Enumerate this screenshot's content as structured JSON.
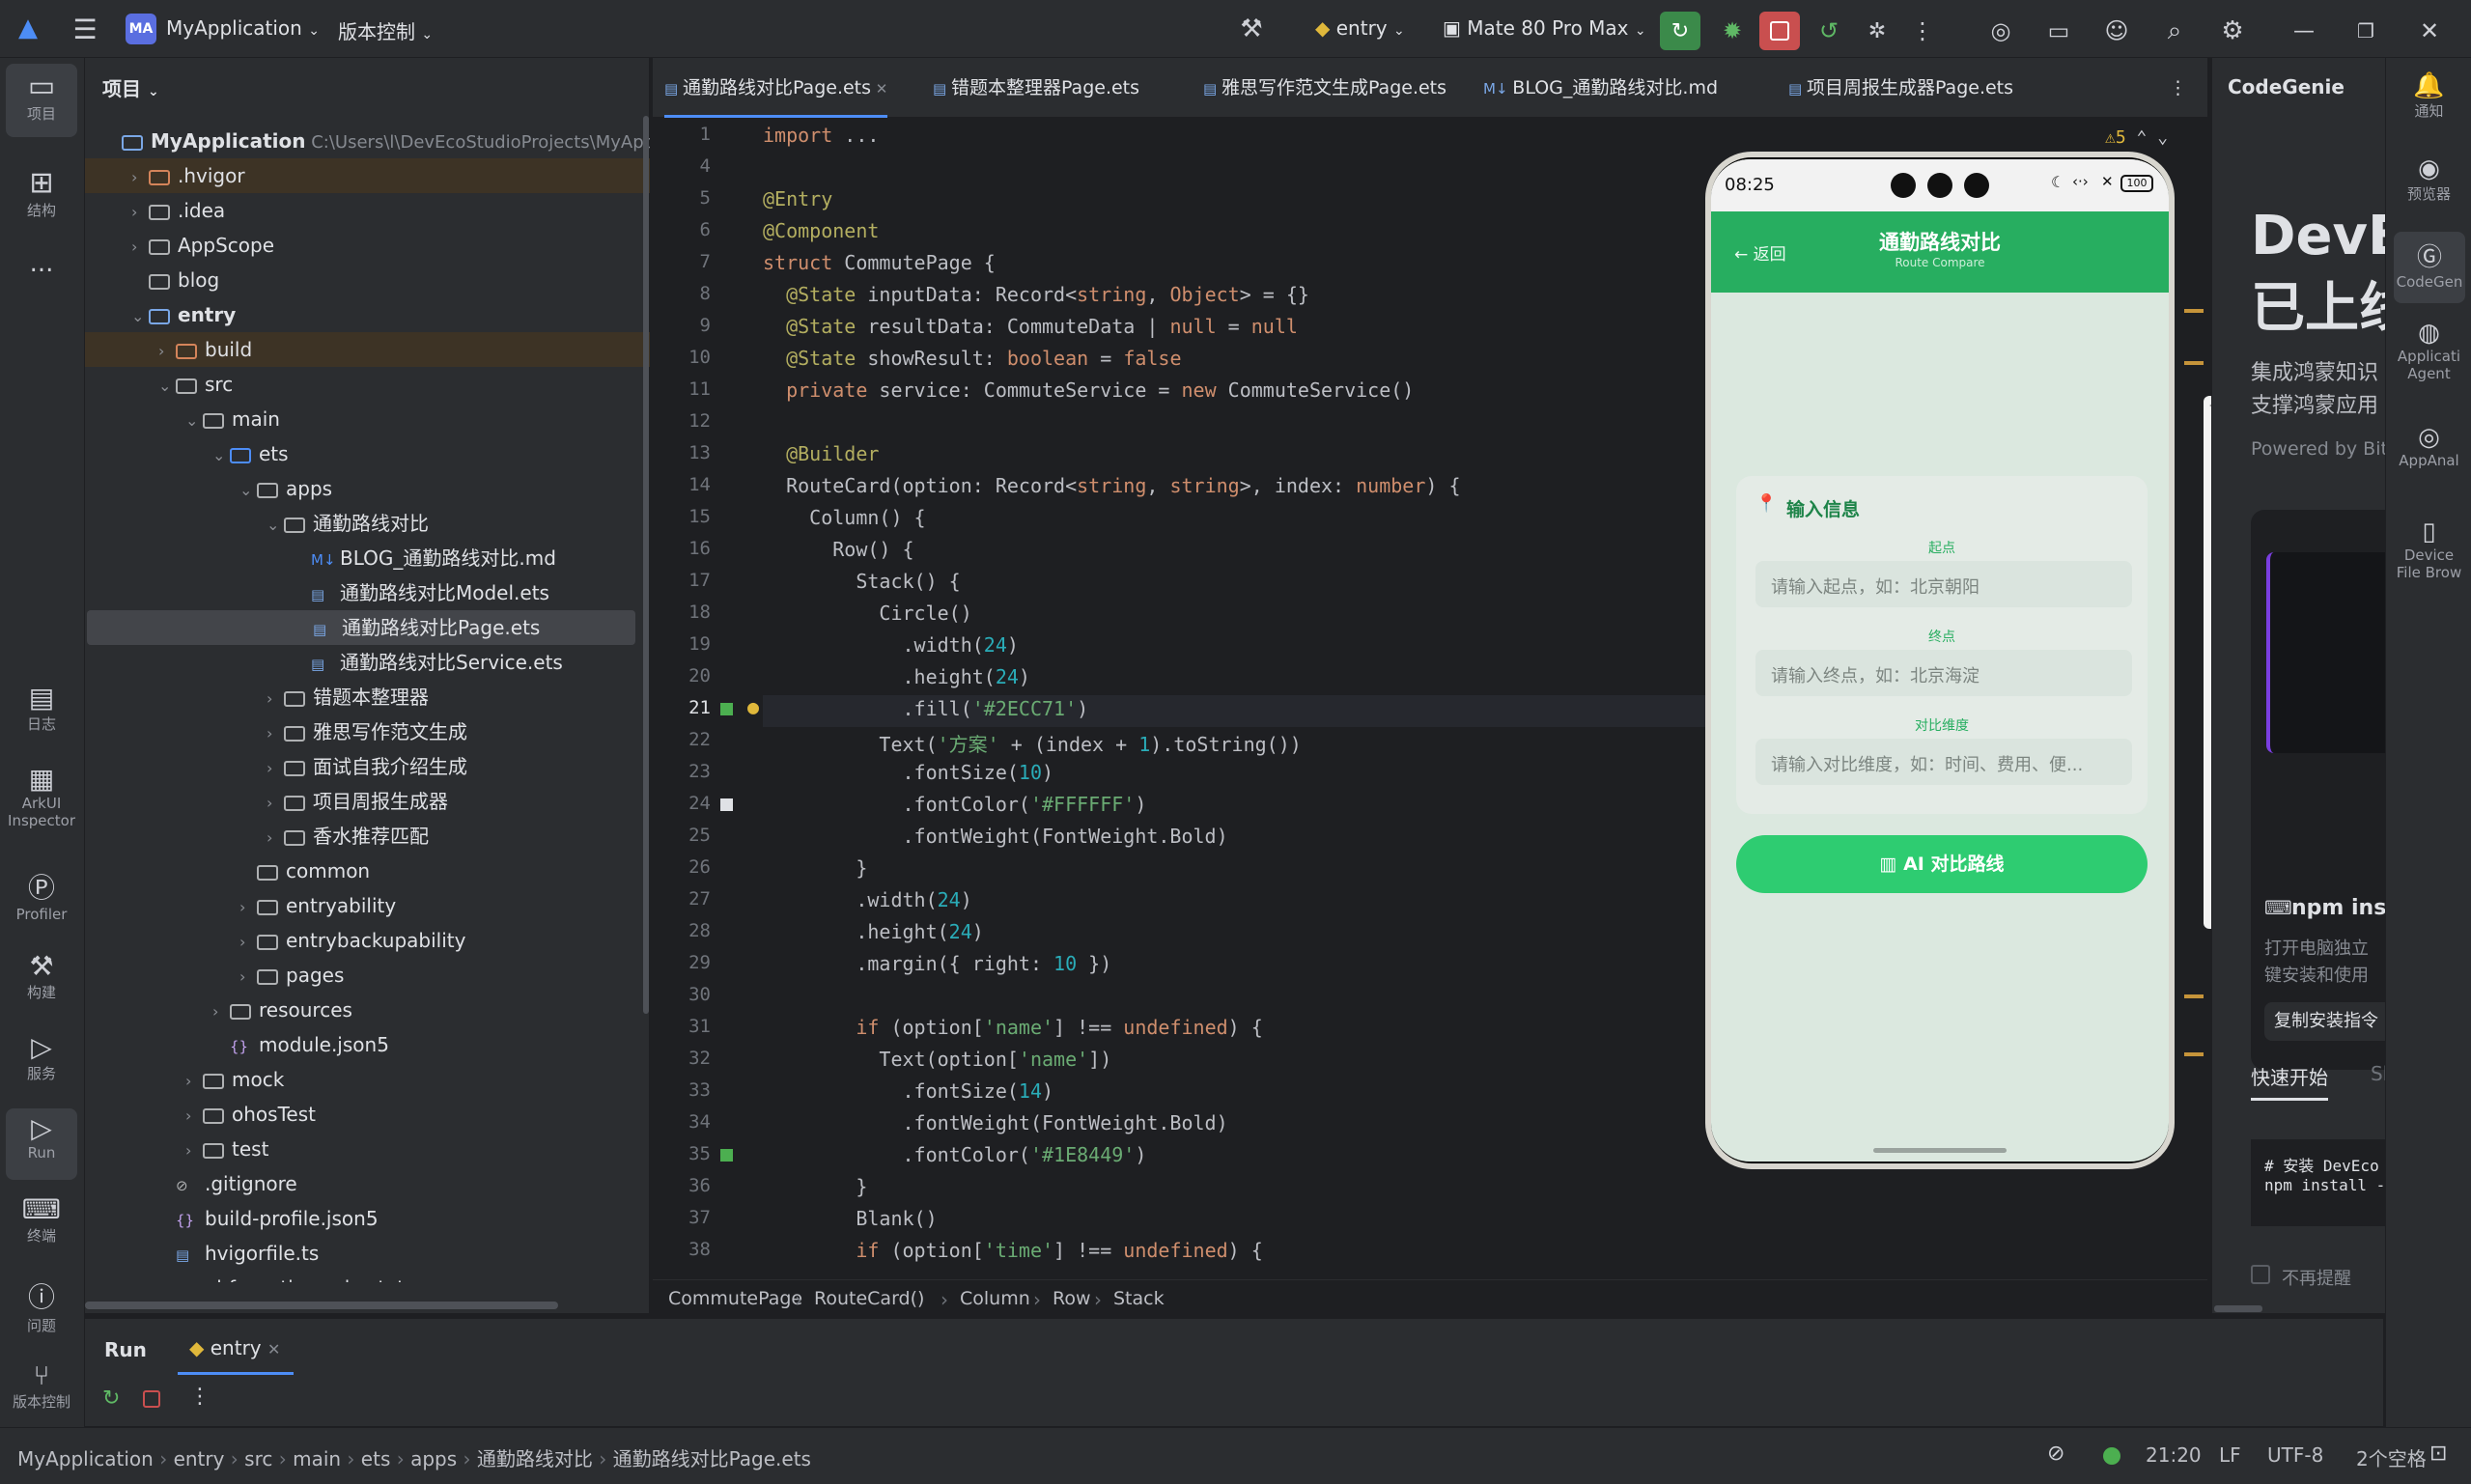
{
  "topbar": {
    "project_name": "MyApplication",
    "project_badge": "MA",
    "vcs_label": "版本控制",
    "run_config": "entry",
    "device": "Mate 80 Pro Max"
  },
  "left_rail": [
    {
      "label": "项目",
      "icon": "folder-icon"
    },
    {
      "label": "结构",
      "icon": "structure-icon"
    },
    {
      "label": "...",
      "icon": "more-icon"
    },
    {
      "label": "日志",
      "icon": "log-icon"
    },
    {
      "label": "ArkUI Inspector",
      "icon": "inspector-icon"
    },
    {
      "label": "Profiler",
      "icon": "profiler-icon"
    },
    {
      "label": "构建",
      "icon": "build-icon"
    },
    {
      "label": "服务",
      "icon": "services-icon"
    },
    {
      "label": "Run",
      "icon": "run-icon"
    },
    {
      "label": "终端",
      "icon": "terminal-icon"
    },
    {
      "label": "问题",
      "icon": "problems-icon"
    },
    {
      "label": "版本控制",
      "icon": "vcs-icon"
    }
  ],
  "project_panel": {
    "title": "项目",
    "tree": [
      {
        "label": "MyApplication",
        "extra": "C:\\Users\\l\\DevEcoStudioProjects\\MyApplic",
        "depth": 0,
        "kind": "root"
      },
      {
        "label": ".hvigor",
        "depth": 1,
        "kind": "folder-excluded",
        "chev": "›"
      },
      {
        "label": ".idea",
        "depth": 1,
        "kind": "folder",
        "chev": "›"
      },
      {
        "label": "AppScope",
        "depth": 1,
        "kind": "folder",
        "chev": "›"
      },
      {
        "label": "blog",
        "depth": 1,
        "kind": "folder",
        "chev": ""
      },
      {
        "label": "entry",
        "depth": 1,
        "kind": "module",
        "chev": "⌄"
      },
      {
        "label": "build",
        "depth": 2,
        "kind": "folder-excluded",
        "chev": "›"
      },
      {
        "label": "src",
        "depth": 2,
        "kind": "folder",
        "chev": "⌄"
      },
      {
        "label": "main",
        "depth": 3,
        "kind": "folder",
        "chev": "⌄"
      },
      {
        "label": "ets",
        "depth": 4,
        "kind": "folder-src",
        "chev": "⌄"
      },
      {
        "label": "apps",
        "depth": 5,
        "kind": "folder",
        "chev": "⌄"
      },
      {
        "label": "通勤路线对比",
        "depth": 6,
        "kind": "folder",
        "chev": "⌄"
      },
      {
        "label": "BLOG_通勤路线对比.md",
        "depth": 7,
        "kind": "md",
        "chev": ""
      },
      {
        "label": "通勤路线对比Model.ets",
        "depth": 7,
        "kind": "ets",
        "chev": ""
      },
      {
        "label": "通勤路线对比Page.ets",
        "depth": 7,
        "kind": "ets",
        "chev": "",
        "selected": true
      },
      {
        "label": "通勤路线对比Service.ets",
        "depth": 7,
        "kind": "ets",
        "chev": ""
      },
      {
        "label": "错题本整理器",
        "depth": 6,
        "kind": "folder",
        "chev": "›"
      },
      {
        "label": "雅思写作范文生成",
        "depth": 6,
        "kind": "folder",
        "chev": "›"
      },
      {
        "label": "面试自我介绍生成",
        "depth": 6,
        "kind": "folder",
        "chev": "›"
      },
      {
        "label": "项目周报生成器",
        "depth": 6,
        "kind": "folder",
        "chev": "›"
      },
      {
        "label": "香水推荐匹配",
        "depth": 6,
        "kind": "folder",
        "chev": "›"
      },
      {
        "label": "common",
        "depth": 5,
        "kind": "folder",
        "chev": ""
      },
      {
        "label": "entryability",
        "depth": 5,
        "kind": "folder",
        "chev": "›"
      },
      {
        "label": "entrybackupability",
        "depth": 5,
        "kind": "folder",
        "chev": "›"
      },
      {
        "label": "pages",
        "depth": 5,
        "kind": "folder",
        "chev": "›"
      },
      {
        "label": "resources",
        "depth": 4,
        "kind": "folder",
        "chev": "›"
      },
      {
        "label": "module.json5",
        "depth": 4,
        "kind": "json",
        "chev": ""
      },
      {
        "label": "mock",
        "depth": 3,
        "kind": "folder",
        "chev": "›"
      },
      {
        "label": "ohosTest",
        "depth": 3,
        "kind": "folder",
        "chev": "›"
      },
      {
        "label": "test",
        "depth": 3,
        "kind": "folder",
        "chev": "›"
      },
      {
        "label": ".gitignore",
        "depth": 2,
        "kind": "ignore",
        "chev": ""
      },
      {
        "label": "build-profile.json5",
        "depth": 2,
        "kind": "json",
        "chev": ""
      },
      {
        "label": "hvigorfile.ts",
        "depth": 2,
        "kind": "ts",
        "chev": ""
      },
      {
        "label": "obfuscation-rules.txt",
        "depth": 2,
        "kind": "txt",
        "chev": ""
      }
    ]
  },
  "tabs": [
    {
      "label": "通勤路线对比Page.ets",
      "active": true
    },
    {
      "label": "错题本整理器Page.ets"
    },
    {
      "label": "雅思写作范文生成Page.ets"
    },
    {
      "label": "BLOG_通勤路线对比.md"
    },
    {
      "label": "项目周报生成器Page.ets"
    }
  ],
  "editor": {
    "warning_count": "5",
    "current_line": 21,
    "line_numbers": [
      "1",
      "4",
      "5",
      "6",
      "7",
      "8",
      "9",
      "10",
      "11",
      "12",
      "13",
      "14",
      "15",
      "16",
      "17",
      "18",
      "19",
      "20",
      "21",
      "22",
      "23",
      "24",
      "25",
      "26",
      "27",
      "28",
      "29",
      "30",
      "31",
      "32",
      "33",
      "34",
      "35",
      "36",
      "37",
      "38"
    ],
    "lines": [
      "import ...",
      "",
      "@Entry",
      "@Component",
      "struct CommutePage {",
      "  @State inputData: Record<string, Object> = {}",
      "  @State resultData: CommuteData | null = null",
      "  @State showResult: boolean = false",
      "  private service: CommuteService = new CommuteService()",
      "",
      "  @Builder",
      "  RouteCard(option: Record<string, string>, index: number) {",
      "    Column() {",
      "      Row() {",
      "        Stack() {",
      "          Circle()",
      "            .width(24)",
      "            .height(24)",
      "            .fill('#2ECC71')",
      "          Text('方案' + (index + 1).toString())",
      "            .fontSize(10)",
      "            .fontColor('#FFFFFF')",
      "            .fontWeight(FontWeight.Bold)",
      "        }",
      "        .width(24)",
      "        .height(24)",
      "        .margin({ right: 10 })",
      "",
      "        if (option['name'] !== undefined) {",
      "          Text(option['name'])",
      "            .fontSize(14)",
      "            .fontWeight(FontWeight.Bold)",
      "            .fontColor('#1E8449')",
      "        }",
      "        Blank()",
      "        if (option['time'] !== undefined) {"
    ],
    "breadcrumb": [
      "CommutePage",
      "RouteCard()",
      "Column",
      "Row",
      "Stack"
    ]
  },
  "phone": {
    "time": "08:25",
    "battery": "100",
    "back_label": "← 返回",
    "title": "通勤路线对比",
    "subtitle": "Route Compare",
    "section_title": "输入信息",
    "fields": [
      {
        "label": "起点",
        "placeholder": "请输入起点，如：北京朝阳"
      },
      {
        "label": "终点",
        "placeholder": "请输入终点，如：北京海淀"
      },
      {
        "label": "对比维度",
        "placeholder": "请输入对比维度，如：时间、费用、便..."
      }
    ],
    "button": "AI 对比路线",
    "accent": "#2ECC71"
  },
  "codegenie": {
    "title": "CodeGenie",
    "hero_line1": "DevEc",
    "hero_line2": "已上线",
    "desc1": "集成鸿蒙知识",
    "desc2": "支撑鸿蒙应用",
    "powered": "Powered by BitF",
    "npm_title": "npm ins",
    "npm_desc1": "打开电脑独立",
    "npm_desc2": "键安装和使用",
    "copy_btn": "复制安装指令",
    "tab_quick": "快速开始",
    "tab_other": "Sk",
    "code1": "# 安装 DevEco",
    "code2": "npm install -",
    "no_remind": "不再提醒"
  },
  "right_rail": [
    {
      "label": "通知",
      "icon": "bell-icon"
    },
    {
      "label": "预览器",
      "icon": "eye-icon"
    },
    {
      "label": "CodeGen",
      "icon": "codegenie-icon"
    },
    {
      "label": "Applicati Agent",
      "icon": "agent-icon"
    },
    {
      "label": "AppAnal",
      "icon": "analyze-icon"
    },
    {
      "label": "Device File Brow",
      "icon": "device-icon"
    }
  ],
  "run_panel": {
    "title": "Run",
    "tab": "entry"
  },
  "status_bar": {
    "path": [
      "MyApplication",
      "entry",
      "src",
      "main",
      "ets",
      "apps",
      "通勤路线对比",
      "通勤路线对比Page.ets"
    ],
    "position": "21:20",
    "line_sep": "LF",
    "encoding": "UTF-8",
    "indent": "2个空格"
  },
  "colors": {
    "accent_green": "#2ECC71",
    "editor_bg": "#1e1f22",
    "panel_bg": "#2b2d30"
  }
}
